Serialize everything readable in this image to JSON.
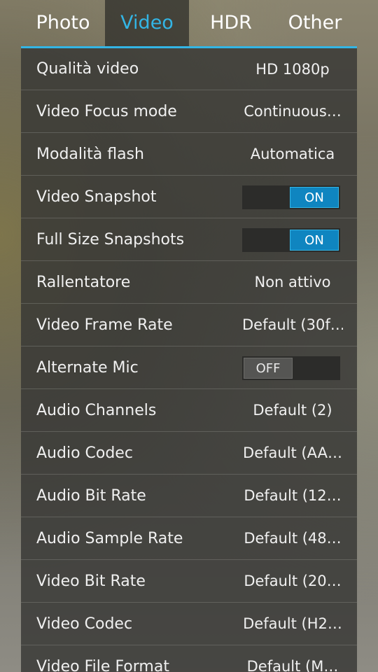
{
  "tabs": [
    {
      "label": "Photo",
      "active": false
    },
    {
      "label": "Video",
      "active": true
    },
    {
      "label": "HDR",
      "active": false
    },
    {
      "label": "Other",
      "active": false
    }
  ],
  "accent_color": "#33b5e5",
  "settings": [
    {
      "label": "Qualità video",
      "value": "HD 1080p"
    },
    {
      "label": "Video Focus mode",
      "value": "Continuous…"
    },
    {
      "label": "Modalità flash",
      "value": "Automatica"
    },
    {
      "label": "Video Snapshot",
      "toggle": "ON"
    },
    {
      "label": "Full Size Snapshots",
      "toggle": "ON"
    },
    {
      "label": "Rallentatore",
      "value": "Non attivo"
    },
    {
      "label": "Video Frame Rate",
      "value": "Default (30f…"
    },
    {
      "label": "Alternate Mic",
      "toggle": "OFF"
    },
    {
      "label": "Audio Channels",
      "value": "Default (2)"
    },
    {
      "label": "Audio Codec",
      "value": "Default (AA…"
    },
    {
      "label": "Audio Bit Rate",
      "value": "Default (12…"
    },
    {
      "label": "Audio Sample Rate",
      "value": "Default (48…"
    },
    {
      "label": "Video Bit Rate",
      "value": "Default (20…"
    },
    {
      "label": "Video Codec",
      "value": "Default (H2…"
    },
    {
      "label": "Video File Format",
      "value": "Default (M…"
    }
  ]
}
